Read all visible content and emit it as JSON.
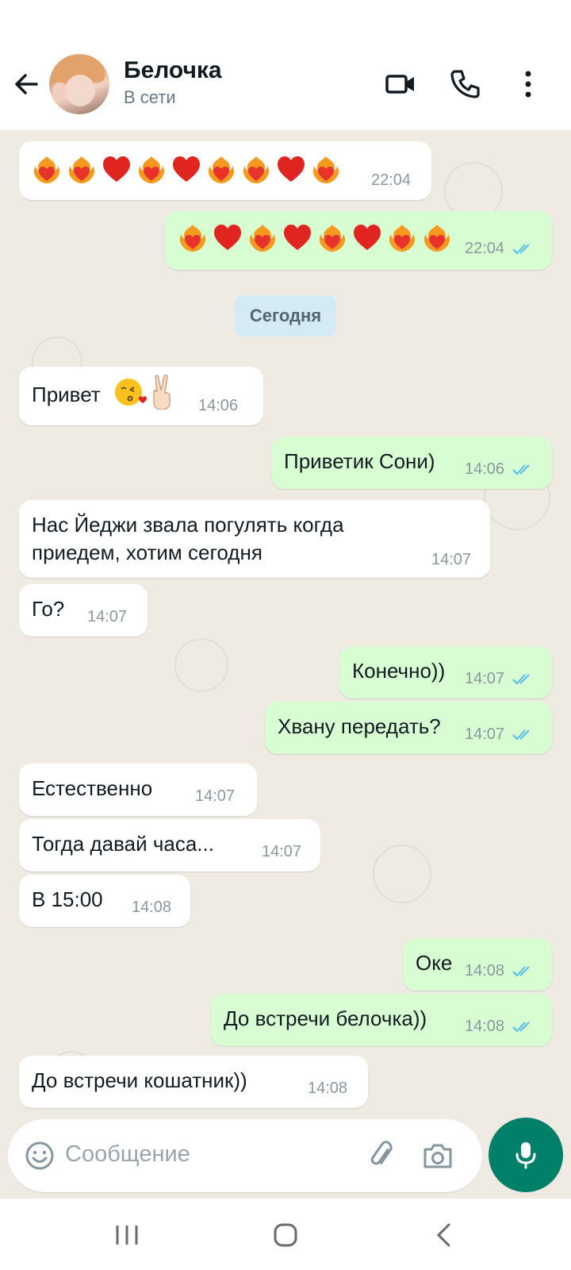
{
  "contact": {
    "name": "Белочка",
    "status": "В сети"
  },
  "date_chip": "Сегодня",
  "messages": [
    {
      "dir": "in",
      "time": "22:04"
    },
    {
      "dir": "out",
      "time": "22:04"
    },
    {
      "dir": "in",
      "text": "Привет",
      "time": "14:06"
    },
    {
      "dir": "out",
      "text": "Приветик Сони)",
      "time": "14:06"
    },
    {
      "dir": "in",
      "text": "Нас Йеджи звала погулять когда\nприедем, хотим сегодня",
      "time": "14:07"
    },
    {
      "dir": "in",
      "text": "Го?",
      "time": "14:07"
    },
    {
      "dir": "out",
      "text": "Конечно))",
      "time": "14:07"
    },
    {
      "dir": "out",
      "text": "Хвану передать?",
      "time": "14:07"
    },
    {
      "dir": "in",
      "text": "Естественно",
      "time": "14:07"
    },
    {
      "dir": "in",
      "text": "Тогда давай часа...",
      "time": "14:07"
    },
    {
      "dir": "in",
      "text": "В 15:00",
      "time": "14:08"
    },
    {
      "dir": "out",
      "text": "Оке",
      "time": "14:08"
    },
    {
      "dir": "out",
      "text": "До встречи белочка))",
      "time": "14:08"
    },
    {
      "dir": "in",
      "text": "До встречи кошатник))",
      "time": "14:08"
    }
  ],
  "composer": {
    "placeholder": "Сообщение"
  },
  "colors": {
    "accent": "#008069",
    "outgoing": "#d9fdd3",
    "incoming": "#ffffff",
    "ticks": "#53bdeb",
    "wallpaper": "#efeae2"
  },
  "icons": [
    "back-arrow-icon",
    "video-call-icon",
    "phone-icon",
    "more-icon",
    "emoji-icon",
    "attach-icon",
    "camera-icon",
    "mic-icon",
    "recents-icon",
    "home-icon",
    "back-nav-icon"
  ]
}
